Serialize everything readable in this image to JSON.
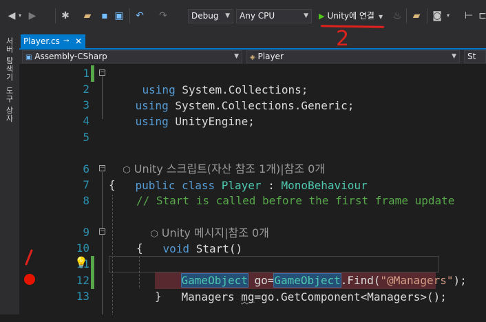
{
  "toolbar": {
    "config_value": "Debug",
    "platform_value": "Any CPU",
    "run_label": "Unity에 연결"
  },
  "side_tabs": [
    "서버 탐색기",
    "도구 상자"
  ],
  "doc_tab": {
    "title": "Player.cs",
    "pin": "⊸",
    "close": "✕"
  },
  "navbar": {
    "project": "Assembly-CSharp",
    "class": "Player",
    "member": "St"
  },
  "annotations": {
    "step1": "/",
    "step2": "2"
  },
  "editor": {
    "line_numbers": [
      "1",
      "2",
      "3",
      "4",
      "5",
      "6",
      "7",
      "8",
      "9",
      "10",
      "11",
      "12",
      "13"
    ],
    "lens_unity_script": "Unity 스크립트(자산 참조 1개)|참조 0개",
    "lens_unity_message": "Unity 메시지|참조 0개",
    "l1_kw": "using",
    "l1_ns": " System.Collections;",
    "l2_kw": "using",
    "l2_ns": " System.Collections.Generic;",
    "l3_kw": "using",
    "l3_ns": " UnityEngine;",
    "l6_kw1": "public",
    "l6_kw2": " class ",
    "l6_type": "Player",
    "l6_colon": " : ",
    "l6_base": "MonoBehaviour",
    "l7": "{",
    "l8_comment": "// Start is called before the first frame update",
    "l9_kw": "void",
    "l9_rest": " Start()",
    "l10": "{",
    "l11_type1": "GameObject",
    "l11_mid": " go=",
    "l11_type2": "GameObject",
    "l11_call": ".Find(",
    "l11_str": "\"@Managers\"",
    "l11_end": ");",
    "l12_a": "Managers ",
    "l12_b": "mg",
    "l12_c": "=go.GetComponent<Managers>();",
    "l13": "}"
  }
}
